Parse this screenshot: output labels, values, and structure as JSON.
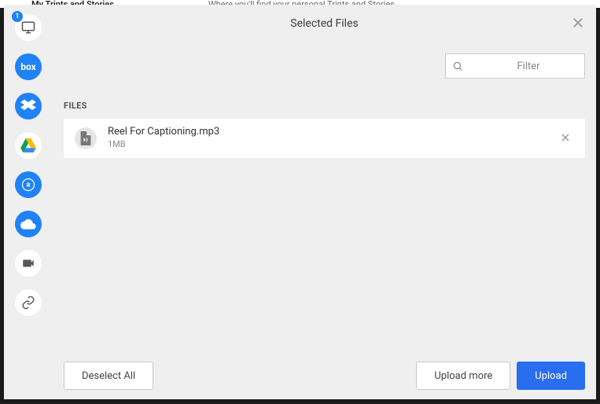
{
  "background": {
    "title": "My Trints and Stories",
    "subtitle": "Where you'll find your personal Trints and Stories"
  },
  "header": {
    "title": "Selected Files"
  },
  "filter": {
    "placeholder": "Filter"
  },
  "section": {
    "label": "FILES"
  },
  "files": [
    {
      "name": "Reel For Captioning.mp3",
      "size": "1MB"
    }
  ],
  "sidebar": {
    "device_badge": "1",
    "box_label": "box"
  },
  "footer": {
    "deselect": "Deselect All",
    "upload_more": "Upload more",
    "upload": "Upload"
  }
}
